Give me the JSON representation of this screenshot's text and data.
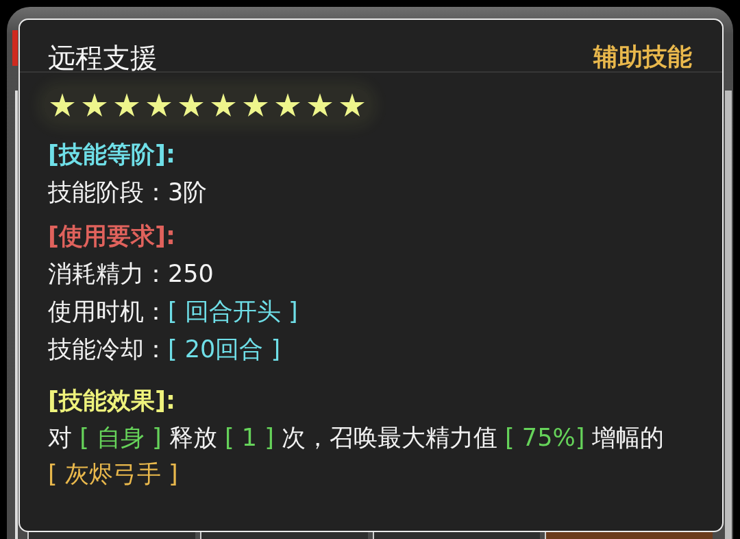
{
  "tooltip": {
    "title": "远程支援",
    "category": "辅助技能",
    "stars": 10,
    "sections": [
      {
        "heading": "[技能等阶]:",
        "color": "#6fdfe8",
        "stats": [
          {
            "label": "技能阶段：",
            "value": "3阶",
            "kind": "plain"
          }
        ]
      },
      {
        "heading": "[使用要求]:",
        "color": "#e0625c",
        "stats": [
          {
            "label": "消耗精力：",
            "value": "250",
            "kind": "plain"
          },
          {
            "label": "使用时机：",
            "value": "[ 回合开头 ]",
            "kind": "tag"
          },
          {
            "label": "技能冷却：",
            "value": "[ 20回合 ]",
            "kind": "tag"
          }
        ]
      },
      {
        "heading": "[技能效果]:",
        "color": "#eef27c",
        "effect": [
          {
            "text": "对 ",
            "kind": "plain"
          },
          {
            "text": "[ 自身 ]",
            "kind": "value"
          },
          {
            "text": " 释放 ",
            "kind": "plain"
          },
          {
            "text": "[ 1 ]",
            "kind": "value"
          },
          {
            "text": " 次，召唤最大精力值 ",
            "kind": "plain"
          },
          {
            "text": "[ 75%]",
            "kind": "value"
          },
          {
            "text": " 增幅的 ",
            "kind": "plain"
          },
          {
            "text": "[ 灰烬弓手 ]",
            "kind": "unit"
          }
        ]
      }
    ]
  }
}
